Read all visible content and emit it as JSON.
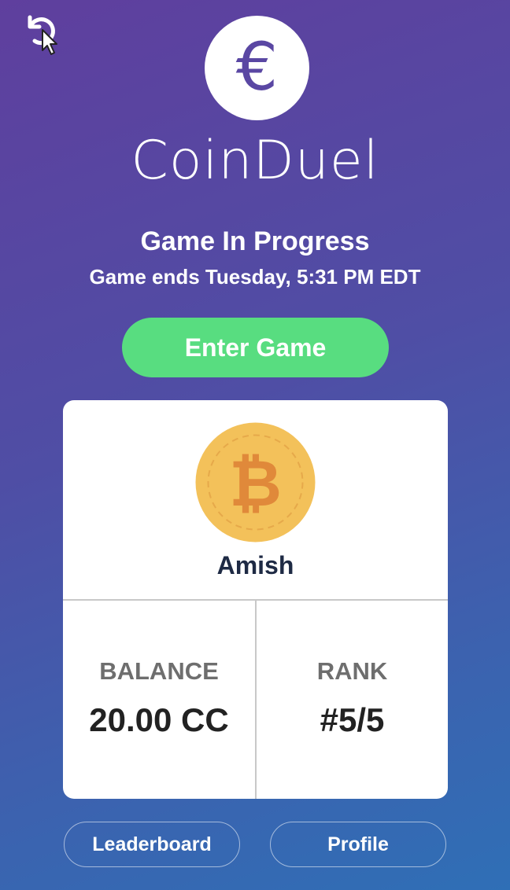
{
  "toolbar": {
    "refresh_icon": "refresh-icon"
  },
  "app": {
    "logo_glyph": "€",
    "logo_icon": "euro-icon",
    "name": "CoinDuel",
    "accent_color": "#5a47a3"
  },
  "game": {
    "status_title": "Game In Progress",
    "status_subtitle": "Game ends Tuesday, 5:31 PM EDT",
    "enter_label": "Enter Game",
    "enter_color": "#58dd80"
  },
  "player": {
    "avatar_icon": "bitcoin-coin-icon",
    "name": "Amish",
    "balance_label": "BALANCE",
    "balance_value": "20.00 CC",
    "rank_label": "RANK",
    "rank_value": "#5/5"
  },
  "nav": {
    "leaderboard_label": "Leaderboard",
    "profile_label": "Profile"
  }
}
